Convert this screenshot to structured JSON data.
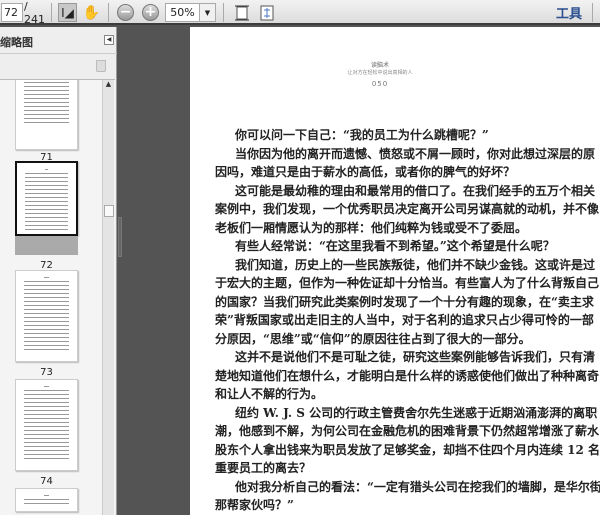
{
  "toolbar": {
    "page_current": "72",
    "page_total": "/ 241",
    "zoom": "50%",
    "tools_label": "工具"
  },
  "sidebar": {
    "title": "缩略图",
    "thumbnails": [
      {
        "label": "71"
      },
      {
        "label": "72",
        "selected": true
      },
      {
        "label": "73"
      },
      {
        "label": "74"
      }
    ]
  },
  "page": {
    "header_title": "读脑术",
    "header_subtitle": "让对方在轻松中说出真相的人",
    "page_number": "050",
    "lines": [
      {
        "t": "你可以问一下自己：“我的员工为什么跳槽呢？”",
        "ind": true,
        "end": true
      },
      {
        "t": "当你因为他的离开而遗憾、愤怒或不屑一顾时，你对此想过深层的原",
        "ind": true
      },
      {
        "t": "因吗，难道只是由于薪水的高低，或者你的脾气的好坏？",
        "end": true
      },
      {
        "t": "这可能是最幼稚的理由和最常用的借口了。在我们经手的五万个相关",
        "ind": true
      },
      {
        "t": "案例中，我们发现，一个优秀职员决定离开公司另谋高就的动机，并不像"
      },
      {
        "t": "老板们一厢情愿认为的那样：他们纯粹为钱或受不了委屈。",
        "end": true
      },
      {
        "t": "有些人经常说：“在这里我看不到希望。”这个希望是什么呢？",
        "ind": true,
        "end": true
      },
      {
        "t": "我们知道，历史上的一些民族叛徒，他们并不缺少金钱。这或许是过",
        "ind": true
      },
      {
        "t": "于宏大的主题，但作为一种佐证却十分恰当。有些富人为了什么背叛自己"
      },
      {
        "t": "的国家？当我们研究此类案例时发现了一个十分有趣的现象，在“卖主求"
      },
      {
        "t": "荣”背叛国家或出走旧主的人当中，对于名利的追求只占少得可怜的一部"
      },
      {
        "t": "分原因，“思维”或“信仰”的原因往往占到了很大的一部分。",
        "end": true
      },
      {
        "t": "这并不是说他们不是可耻之徒，研究这些案例能够告诉我们，只有清",
        "ind": true
      },
      {
        "t": "楚地知道他们在想什么，才能明白是什么样的诱惑使他们做出了种种离奇"
      },
      {
        "t": "和让人不解的行为。",
        "end": true
      },
      {
        "t": "纽约 W. J. S 公司的行政主管费舍尔先生迷惑于近期汹涌澎湃的离职",
        "ind": true
      },
      {
        "t": "潮，他感到不解，为何公司在金融危机的困难背景下仍然超常增涨了薪水，"
      },
      {
        "t": "股东个人拿出钱来为职员发放了足够奖金，却挡不住四个月内连续 12 名"
      },
      {
        "t": "重要员工的离去？",
        "end": true
      },
      {
        "t": "他对我分析自己的看法：“一定有猎头公司在挖我们的墙脚，是华尔街",
        "ind": true
      },
      {
        "t": "那帮家伙吗？”",
        "end": true
      }
    ]
  }
}
